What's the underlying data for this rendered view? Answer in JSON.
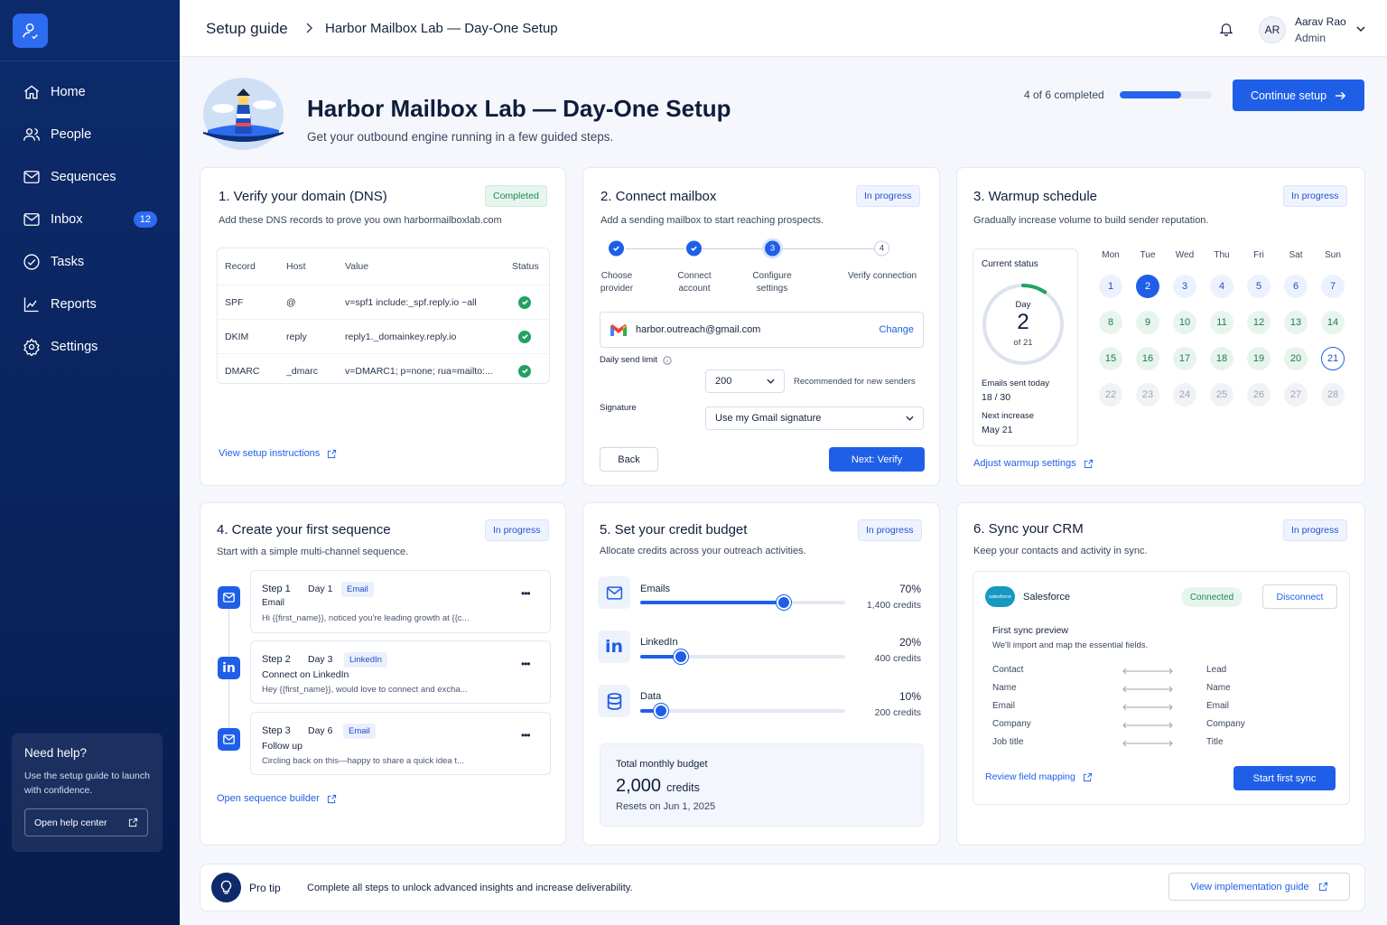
{
  "sidebar": {
    "items": [
      {
        "label": "Home"
      },
      {
        "label": "People"
      },
      {
        "label": "Sequences"
      },
      {
        "label": "Inbox",
        "badge": "12"
      },
      {
        "label": "Tasks"
      },
      {
        "label": "Reports"
      },
      {
        "label": "Settings"
      }
    ],
    "help": {
      "title": "Need help?",
      "text": "Use the setup guide to launch with confidence.",
      "button": "Open help center"
    }
  },
  "topbar": {
    "breadcrumb_root": "Setup guide",
    "breadcrumb_current": "Harbor Mailbox Lab — Day-One Setup",
    "user_initials": "AR",
    "user_name": "Aarav Rao",
    "user_role": "Admin"
  },
  "header": {
    "title": "Harbor Mailbox Lab — Day-One Setup",
    "subtitle": "Get your outbound engine running in a few guided steps.",
    "progress_text": "4 of 6 completed",
    "progress_fraction": 0.67,
    "continue_label": "Continue setup"
  },
  "dns": {
    "title": "1.  Verify your domain (DNS)",
    "status": "Completed",
    "desc": "Add these DNS records to prove you own harbormailboxlab.com",
    "headers": [
      "Record",
      "Host",
      "Value",
      "Status"
    ],
    "rows": [
      {
        "record": "SPF",
        "host": "@",
        "value": "v=spf1 include:_spf.reply.io ~all"
      },
      {
        "record": "DKIM",
        "host": "reply",
        "value": "reply1._domainkey.reply.io"
      },
      {
        "record": "DMARC",
        "host": "_dmarc",
        "value": "v=DMARC1; p=none; rua=mailto:..."
      }
    ],
    "link": "View setup instructions"
  },
  "mailbox": {
    "title": "2.  Connect mailbox",
    "status": "In progress",
    "desc": "Add a sending mailbox to start reaching prospects.",
    "steps": [
      {
        "n": "1",
        "label": "Choose provider"
      },
      {
        "n": "2",
        "label": "Connect account"
      },
      {
        "n": "3",
        "label": "Configure settings"
      },
      {
        "n": "4",
        "label": "Verify connection"
      }
    ],
    "email": "harbor.outreach@gmail.com",
    "change": "Change",
    "limit_label": "Daily send limit",
    "limit_value": "200",
    "limit_hint": "Recommended for new senders",
    "signature_label": "Signature",
    "signature_value": "Use my Gmail signature",
    "back": "Back",
    "next": "Next: Verify"
  },
  "warmup": {
    "title": "3.  Warmup schedule",
    "status": "In progress",
    "desc": "Gradually increase volume to build sender reputation.",
    "current_status": "Current status",
    "day_word": "Day",
    "day": "2",
    "of_days": "of 21",
    "day_fraction": 0.095,
    "sent_label": "Emails sent today",
    "sent_value": "18 / 30",
    "next_label": "Next increase",
    "next_value": "May 21",
    "weekdays": [
      "Mon",
      "Tue",
      "Wed",
      "Thu",
      "Fri",
      "Sat",
      "Sun"
    ],
    "days": [
      "1",
      "2",
      "3",
      "4",
      "5",
      "6",
      "7",
      "8",
      "9",
      "10",
      "11",
      "12",
      "13",
      "14",
      "15",
      "16",
      "17",
      "18",
      "19",
      "20",
      "21",
      "22",
      "23",
      "24",
      "25",
      "26",
      "27",
      "28"
    ],
    "link": "Adjust warmup settings"
  },
  "sequence": {
    "title": "4.  Create your first sequence",
    "status": "In progress",
    "desc": "Start with a simple multi-channel sequence.",
    "steps": [
      {
        "step": "Step 1",
        "day": "Day 1",
        "tag": "Email",
        "title": "Email",
        "preview": "Hi {{first_name}}, noticed you're leading growth at {{c..."
      },
      {
        "step": "Step 2",
        "day": "Day 3",
        "tag": "LinkedIn",
        "title": "Connect on LinkedIn",
        "preview": "Hey {{first_name}}, would love to connect and excha..."
      },
      {
        "step": "Step 3",
        "day": "Day 6",
        "tag": "Email",
        "title": "Follow up",
        "preview": "Circling back on this—happy to share a quick idea t..."
      }
    ],
    "more": "•••",
    "link": "Open sequence builder"
  },
  "credits": {
    "title": "5.  Set your credit budget",
    "status": "In progress",
    "desc": "Allocate credits across your outreach activities.",
    "items": [
      {
        "name": "Emails",
        "pct": "70%",
        "credits": "1,400 credits",
        "fraction": 0.7
      },
      {
        "name": "LinkedIn",
        "pct": "20%",
        "credits": "400 credits",
        "fraction": 0.2
      },
      {
        "name": "Data",
        "pct": "10%",
        "credits": "200 credits",
        "fraction": 0.1
      }
    ],
    "total_label": "Total monthly budget",
    "total_value": "2,000",
    "total_unit": "credits",
    "resets": "Resets on Jun 1, 2025"
  },
  "crm": {
    "title": "6.  Sync your CRM",
    "status": "In progress",
    "desc": "Keep your contacts and activity in sync.",
    "provider": "Salesforce",
    "logo_text": "salesforce",
    "connected": "Connected",
    "disconnect": "Disconnect",
    "preview_title": "First sync preview",
    "preview_desc": "We'll import and map the essential fields.",
    "map_from": [
      "Contact",
      "Name",
      "Email",
      "Company",
      "Job title"
    ],
    "map_to": [
      "Lead",
      "Name",
      "Email",
      "Company",
      "Title"
    ],
    "link": "Review field mapping",
    "start": "Start first sync"
  },
  "tip": {
    "label": "Pro tip",
    "text": "Complete all steps to unlock advanced insights and increase deliverability.",
    "button": "View implementation guide"
  },
  "colors": {
    "primary": "#1f5fe8",
    "sidebar": "#0a245e",
    "success": "#22a163"
  }
}
